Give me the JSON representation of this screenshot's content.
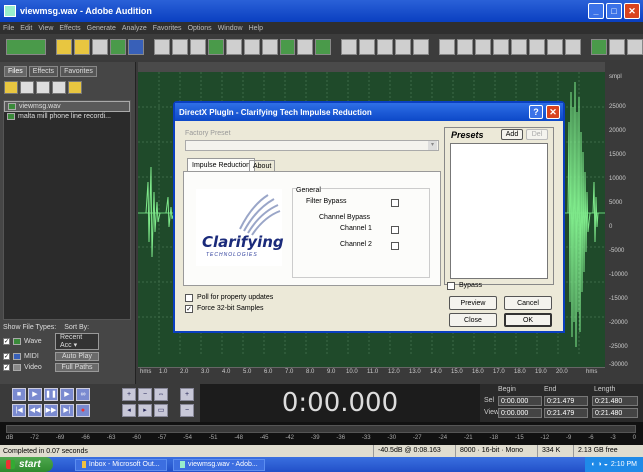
{
  "window": {
    "title": "viewmsg.wav - Adobe Audition"
  },
  "menu": [
    "File",
    "Edit",
    "View",
    "Effects",
    "Generate",
    "Analyze",
    "Favorites",
    "Options",
    "Window",
    "Help"
  ],
  "left_panel": {
    "tabs": [
      "Files",
      "Effects",
      "Favorites"
    ],
    "files": [
      "viewmsg.wav",
      "malta mill phone line recordi..."
    ],
    "show_file_types_label": "Show File Types:",
    "sort_by_label": "Sort By:",
    "types": [
      "Wave",
      "MIDI",
      "Video"
    ],
    "sort_value": "Recent Acc",
    "auto_play": "Auto Play",
    "full_paths": "Full Paths"
  },
  "ruler": {
    "left_label": "hms",
    "right_label": "hms",
    "ticks": [
      "1.0",
      "2.0",
      "3.0",
      "4.0",
      "5.0",
      "6.0",
      "7.0",
      "8.0",
      "9.0",
      "10.0",
      "11.0",
      "12.0",
      "13.0",
      "14.0",
      "15.0",
      "16.0",
      "17.0",
      "18.0",
      "19.0",
      "20.0"
    ]
  },
  "amp_scale": {
    "top": "smpl",
    "ticks": [
      "25000",
      "20000",
      "15000",
      "10000",
      "5000",
      "0",
      "-5000",
      "-10000",
      "-15000",
      "-20000",
      "-25000",
      "-30000"
    ]
  },
  "time_display": "0:00.000",
  "selview": {
    "headers": [
      "Begin",
      "End",
      "Length"
    ],
    "sel_label": "Sel",
    "view_label": "View",
    "sel": [
      "0:00.000",
      "0:21.479",
      "0:21.480"
    ],
    "view": [
      "0:00.000",
      "0:21.479",
      "0:21.480"
    ]
  },
  "level_labels": [
    "dB",
    "-72",
    "-69",
    "-66",
    "-63",
    "-60",
    "-57",
    "-54",
    "-51",
    "-48",
    "-45",
    "-42",
    "-39",
    "-36",
    "-33",
    "-30",
    "-27",
    "-24",
    "-21",
    "-18",
    "-15",
    "-12",
    "-9",
    "-6",
    "-3",
    "0"
  ],
  "status": {
    "message": "Completed in 0.07 seconds",
    "level": "-40.5dB @ 0:08.163",
    "format": "8000 · 16-bit · Mono",
    "size": "334 K",
    "free": "2.13 GB free"
  },
  "taskbar": {
    "start": "start",
    "tasks": [
      "Inbox - Microsoft Out...",
      "viewmsg.wav - Adob..."
    ],
    "clock": "2:10 PM"
  },
  "dialog": {
    "title": "DirectX PlugIn - Clarifying Tech Impulse Reduction",
    "factory_preset": "Factory Preset",
    "tabs": [
      "Impulse Reduction",
      "About"
    ],
    "general": "General",
    "filter_bypass": "Filter Bypass",
    "channel_bypass": "Channel Bypass",
    "channel1": "Channel 1",
    "channel2": "Channel 2",
    "logo_main": "Clarifying",
    "logo_sub": "TECHNOLOGIES",
    "presets": "Presets",
    "add": "Add",
    "del": "Del",
    "bypass": "Bypass",
    "preview": "Preview",
    "cancel": "Cancel",
    "close": "Close",
    "ok": "OK",
    "poll": "Poll for property updates",
    "force32": "Force 32-bit Samples"
  }
}
